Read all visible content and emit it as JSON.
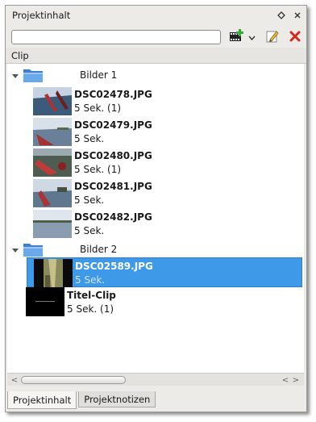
{
  "panel": {
    "title": "Projektinhalt",
    "float_icon": "float-icon",
    "close_icon": "close-icon"
  },
  "toolbar": {
    "search_value": "",
    "add_clip_icon": "film-add-icon",
    "edit_icon": "edit-pencil-icon",
    "delete_icon": "delete-x-icon"
  },
  "tree": {
    "column_header": "Clip",
    "folders": [
      {
        "label": "Bilder 1",
        "clips": [
          {
            "name": "DSC02478.JPG",
            "info": "5 Sek. (1)"
          },
          {
            "name": "DSC02479.JPG",
            "info": "5 Sek."
          },
          {
            "name": "DSC02480.JPG",
            "info": "5 Sek. (1)"
          },
          {
            "name": "DSC02481.JPG",
            "info": "5 Sek."
          },
          {
            "name": "DSC02482.JPG",
            "info": "5 Sek."
          }
        ]
      },
      {
        "label": "Bilder 2",
        "clips": [
          {
            "name": "DSC02589.JPG",
            "info": "5 Sek.",
            "selected": true
          }
        ]
      }
    ],
    "title_clip": {
      "name": "Titel-Clip",
      "info": "5 Sek. (1)"
    }
  },
  "tabs": [
    {
      "label": "Projektinhalt",
      "active": true
    },
    {
      "label": "Projektnotizen",
      "active": false
    }
  ],
  "colors": {
    "selection": "#3e9ae8",
    "folder": "#4a8fd8",
    "delete": "#d42a1e"
  }
}
